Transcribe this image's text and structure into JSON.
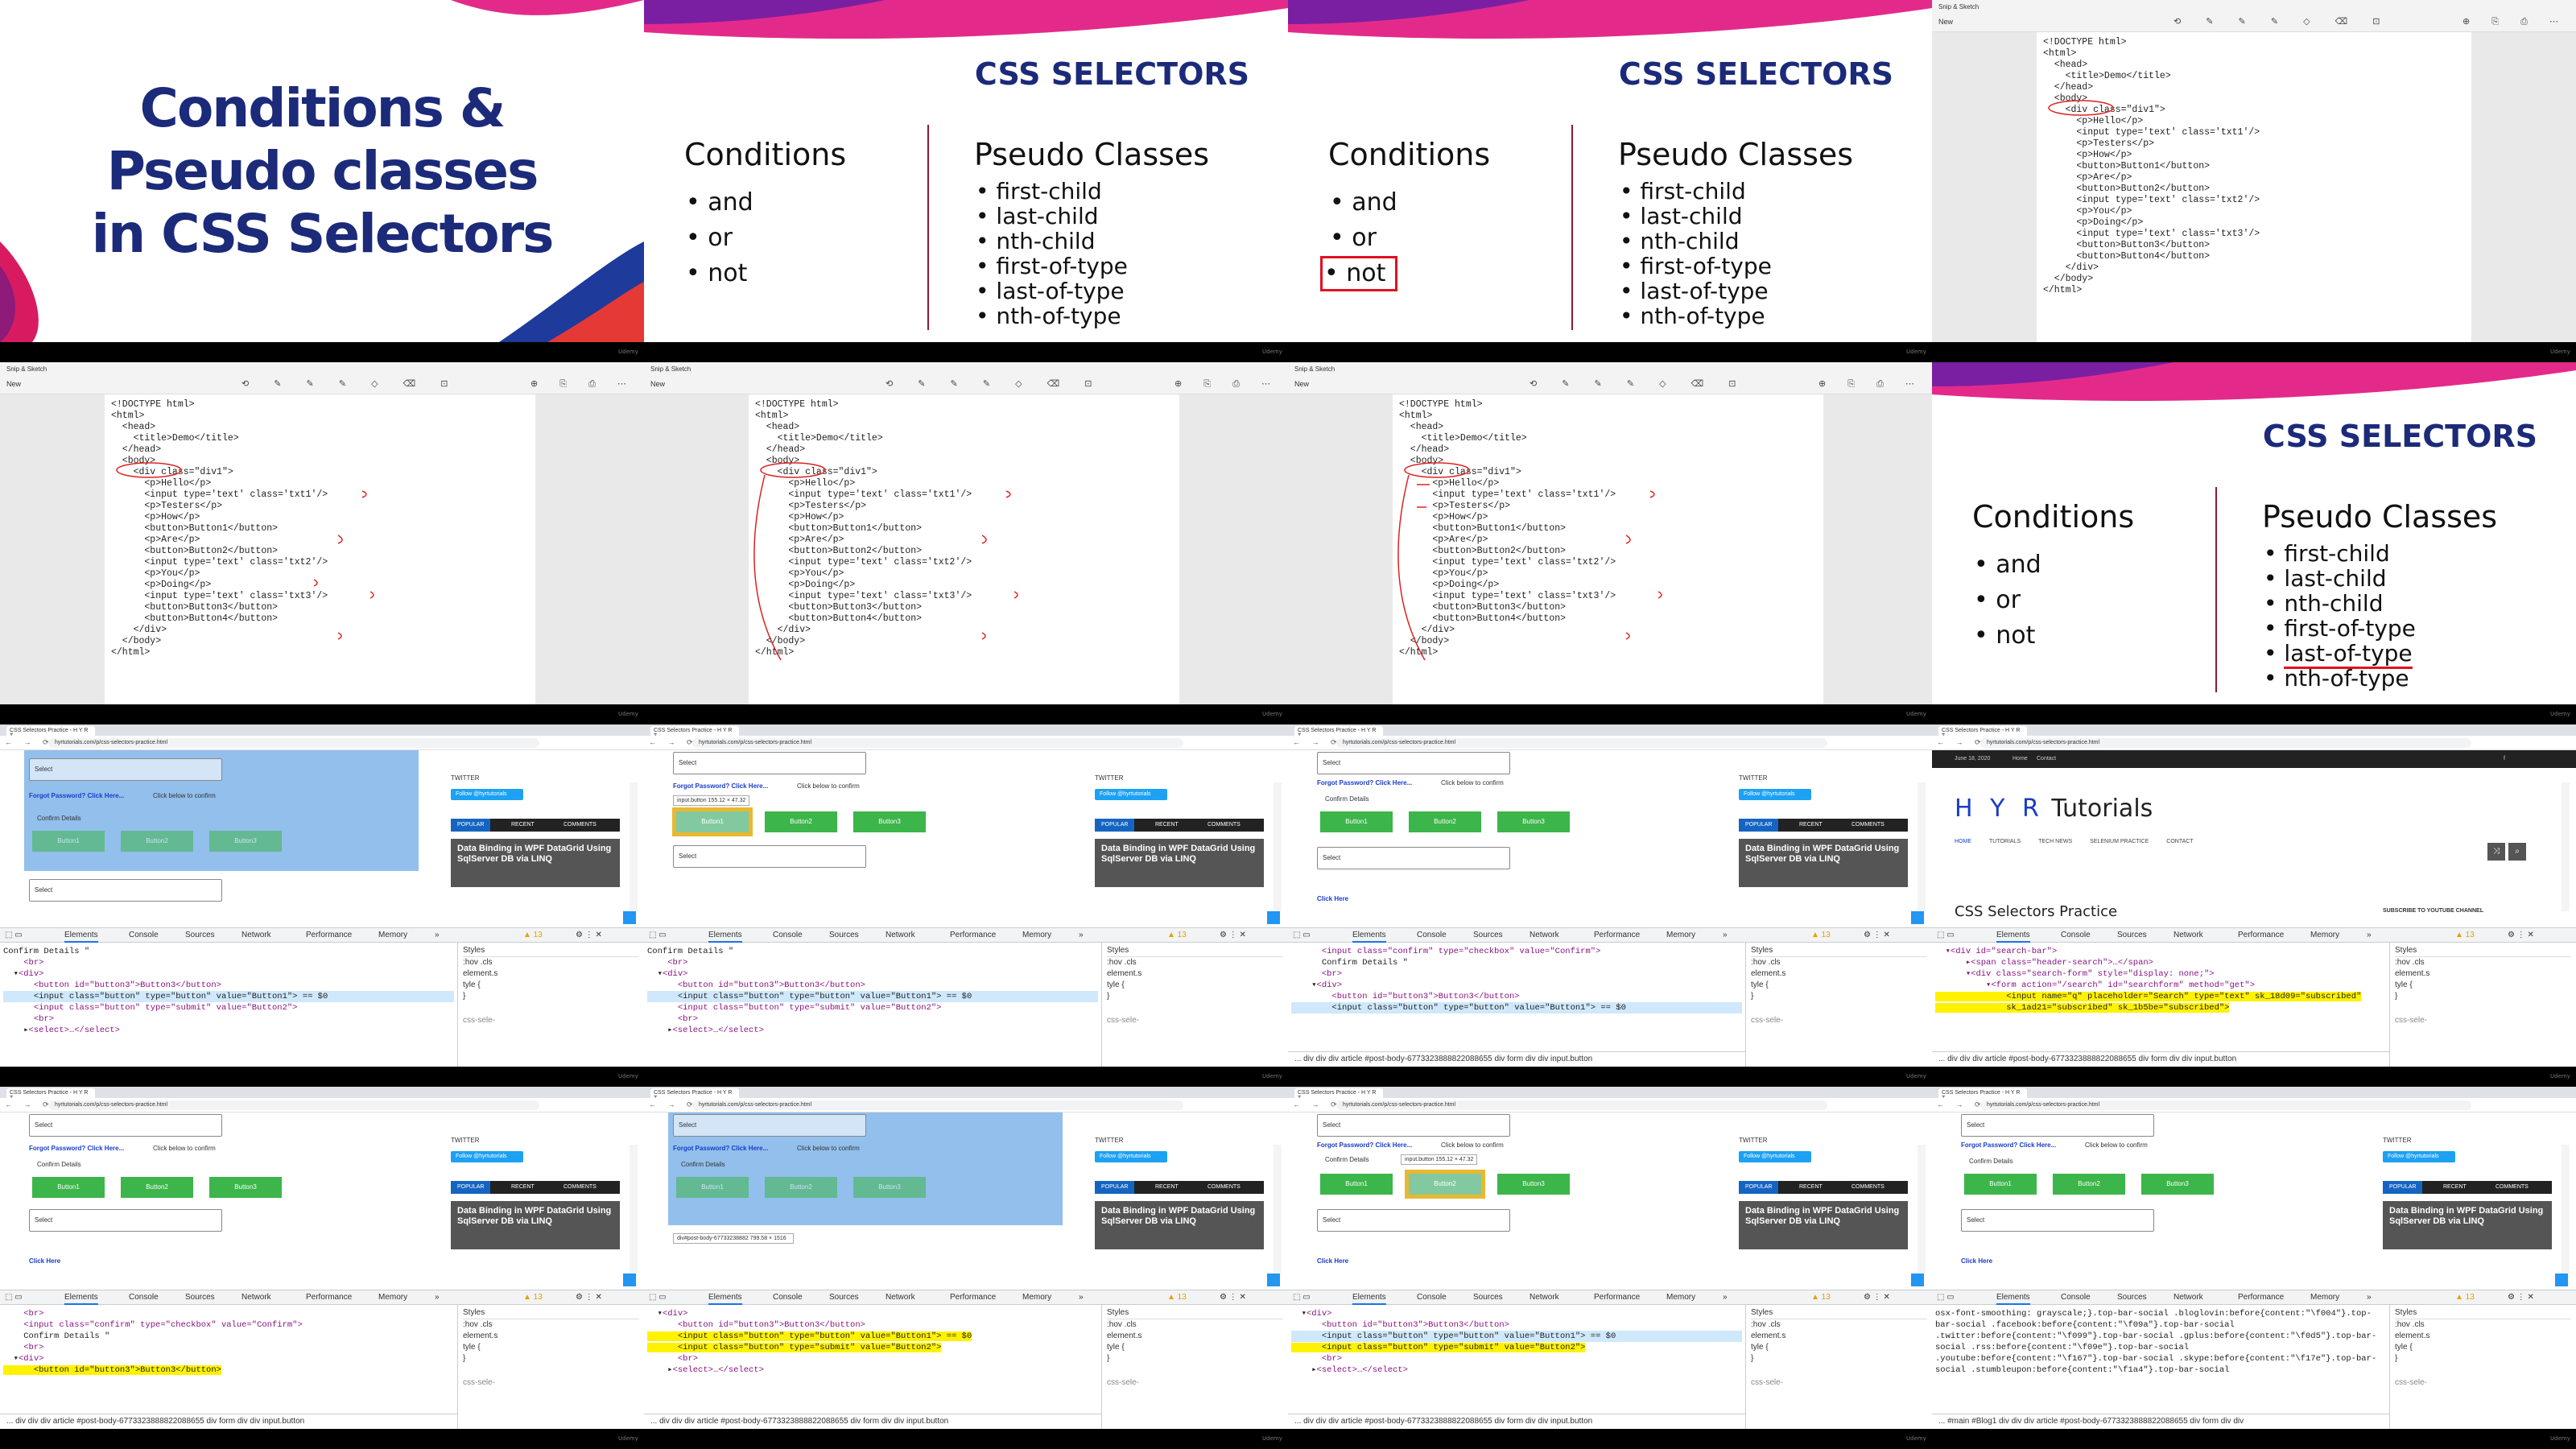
{
  "footer_brand": "Udemy",
  "slide": {
    "title_lines": [
      "Conditions &",
      "Pseudo classes",
      "in CSS Selectors"
    ],
    "header": "CSS SELECTORS",
    "conditions_title": "Conditions",
    "conditions": [
      "and",
      "or",
      "not"
    ],
    "pseudo_title": "Pseudo Classes",
    "pseudo": [
      "first-child",
      "last-child",
      "nth-child",
      "first-of-type",
      "last-of-type",
      "nth-of-type"
    ]
  },
  "snip": {
    "app_title": "Snip & Sketch",
    "new_label": "New",
    "tools": "⟲ ✎ ✎ ✎ ◇ ⌫ ⊡",
    "right_tools": "⊕ ⎘ ⎙ ⋯",
    "code_lines": [
      "<!DOCTYPE html>",
      "<html>",
      "  <head>",
      "    <title>Demo</title>",
      "  </head>",
      "  <body>",
      "    <div class=\"div1\">",
      "      <p>Hello</p>",
      "      <input type='text' class='txt1'/>",
      "      <p>Testers</p>",
      "      <p>How</p>",
      "      <button>Button1</button>",
      "      <p>Are</p>",
      "      <button>Button2</button>",
      "      <input type='text' class='txt2'/>",
      "      <p>You</p>",
      "      <p>Doing</p>",
      "      <input type='text' class='txt3'/>",
      "      <button>Button3</button>",
      "      <button>Button4</button>",
      "    </div>",
      "  </body>",
      "</html>"
    ]
  },
  "browser": {
    "tab_title": "CSS Selectors Practice - H Y R T...",
    "url": "hyrtutorials.com/p/css-selectors-practice.html",
    "select_label": "Select",
    "forgot_link": "Forgot Password? Click Here...",
    "click_below": "Click below to confirm",
    "confirm_details": "Confirm Details",
    "buttons": [
      "Button1",
      "Button2",
      "Button3"
    ],
    "click_here": "Click Here",
    "twitter": "TWITTER",
    "follow": "Follow @hyrtutorials",
    "side_tabs": [
      "POPULAR",
      "RECENT",
      "COMMENTS"
    ],
    "side_article": "Data Binding in WPF DataGrid Using SqlServer DB via LINQ",
    "side_article_short": "Data Binding in WPF DataGrid Using SqlServer DB via LINQ",
    "tooltip_input": "input.button 155.12 × 47.32",
    "tooltip_div": "div#post-body-67733238882 799.58 × 1516",
    "dev_tabs": [
      "Elements",
      "Console",
      "Sources",
      "Network",
      "Performance",
      "Memory",
      "»"
    ],
    "warnings": "▲ 13",
    "styles_title": "Styles",
    "styles_hov": ":hov .cls",
    "styles_element": "element.s",
    "styles_type": "tyle {",
    "styles_brace": "}",
    "styles_css": "css-sele-",
    "crumbs": "...  div  div  div  article  #post-body-6773323888822088655  div  form  div  div  input.button",
    "crumbs2": "...  div  div  div  article  #post-body-6773323888822088655  div  form  div  div  input.button",
    "crumbs_main": "...  #main  #Blog1  div  div  div  article  #post-body-6773323888822088655  div  form  div  div",
    "code_confirm": "Confirm Details \"",
    "code_b3": "<button id=\"button3\">Button3</button>",
    "code_in1": "<input class=\"button\" type=\"button\" value=\"Button1\"> == $0",
    "code_in2": "<input class=\"button\" type=\"submit\" value=\"Button2\">",
    "code_br": "<br>",
    "code_div": "<div>",
    "code_select": "<select>…</select>",
    "code_checkbox": "<input class=\"confirm\" type=\"checkbox\" value=\"Confirm\">",
    "hyr": {
      "date": "June 18, 2020",
      "home": "Home",
      "contact": "Contact",
      "logo_letters": "H Y R",
      "logo_word": "Tutorials",
      "menu": [
        "HOME",
        "TUTORIALS",
        "TECH NEWS",
        "SELENIUM PRACTICE",
        "CONTACT"
      ],
      "page_heading": "CSS Selectors Practice",
      "subscribe": "SUBSCRIBE TO YOUTUBE CHANNEL",
      "code": [
        "▾<div id=\"search-bar\">",
        "  ▸<span class=\"header-search\">…</span>",
        "  ▾<div class=\"search-form\" style=\"display: none;\">",
        "    ▾<form action=\"/search\" id=\"searchform\" method=\"get\">",
        "      <input name=\"q\" placeholder=\"Search\" type=\"text\" sk_18d09=\"subscribed\"",
        "      sk_1ad21=\"subscribed\" sk_1b5be=\"subscribed\">"
      ]
    },
    "social_code": [
      "osx-font-smoothing: grayscale;}.top-bar-social .bloglovin:before{content:\"\\f004\"}.top-",
      "bar-social .facebook:before{content:\"\\f09a\"}.top-bar-social",
      ".twitter:before{content:\"\\f099\"}.top-bar-social .gplus:before{content:\"\\f0d5\"}.top-bar-",
      "social .rss:before{content:\"\\f09e\"}.top-bar-social",
      ".youtube:before{content:\"\\f167\"}.top-bar-social .skype:before{content:\"\\f17e\"}.top-bar-",
      "social .stumbleupon:before{content:\"\\f1a4\"}.top-bar-social"
    ]
  }
}
